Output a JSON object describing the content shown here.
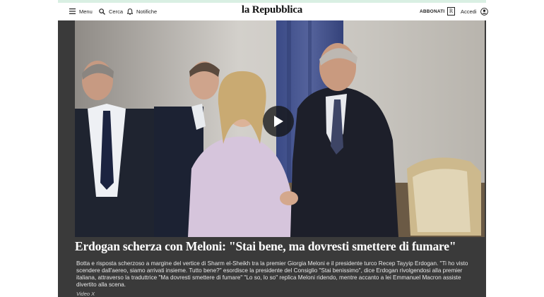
{
  "header": {
    "menu_label": "Menu",
    "search_label": "Cerca",
    "notifications_label": "Notifiche",
    "logo_text": "la Repubblica",
    "subscribe_label": "ABBONATI",
    "r_badge": "R",
    "login_label": "Accedi"
  },
  "video": {
    "title": "Erdogan scherza con Meloni: \"Stai bene, ma dovresti smettere di fumare\"",
    "description": "Botta e risposta scherzoso a margine del vertice di Sharm el-Sheikh tra la premier Giorgia Meloni e il presidente turco Recep Tayyip Erdogan. \"Ti ho visto scendere dall'aereo, siamo arrivati insieme. Tutto bene?\" esordisce la presidente del Consiglio \"Stai benissimo\", dice Erdogan rivolgendosi alla premier italiana, attraverso la traduttrice \"Ma dovresti smettere di fumare\" \"Lo so, lo so\" replica Meloni ridendo, mentre accanto a lei Emmanuel Macron assiste divertito alla scena.",
    "credit": "Video X"
  },
  "colors": {
    "top_accent": "#d9efe3",
    "video_bg": "#3a3a3a"
  }
}
